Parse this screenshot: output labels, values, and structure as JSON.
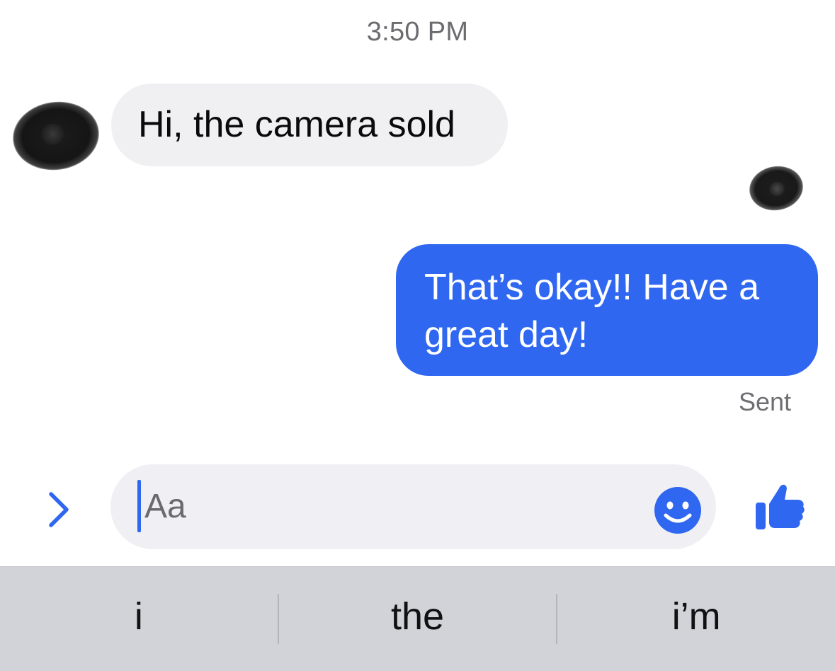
{
  "conversation": {
    "timestamp": "3:50 PM",
    "messages": [
      {
        "direction": "incoming",
        "text": "Hi, the camera sold"
      },
      {
        "direction": "outgoing",
        "text": "That’s okay!! Have a great day!",
        "status": "Sent"
      }
    ]
  },
  "composer": {
    "placeholder": "Aa",
    "icons": [
      "chevron-right-icon",
      "smiley-icon",
      "thumbs-up-icon"
    ]
  },
  "keyboard": {
    "suggestions": [
      "i",
      "the",
      "i’m"
    ]
  },
  "colors": {
    "accent": "#2f67f0",
    "incoming_bubble": "#f0f0f3",
    "composer_bg": "#f0f0f4",
    "suggestion_bar": "#d1d3d9"
  }
}
